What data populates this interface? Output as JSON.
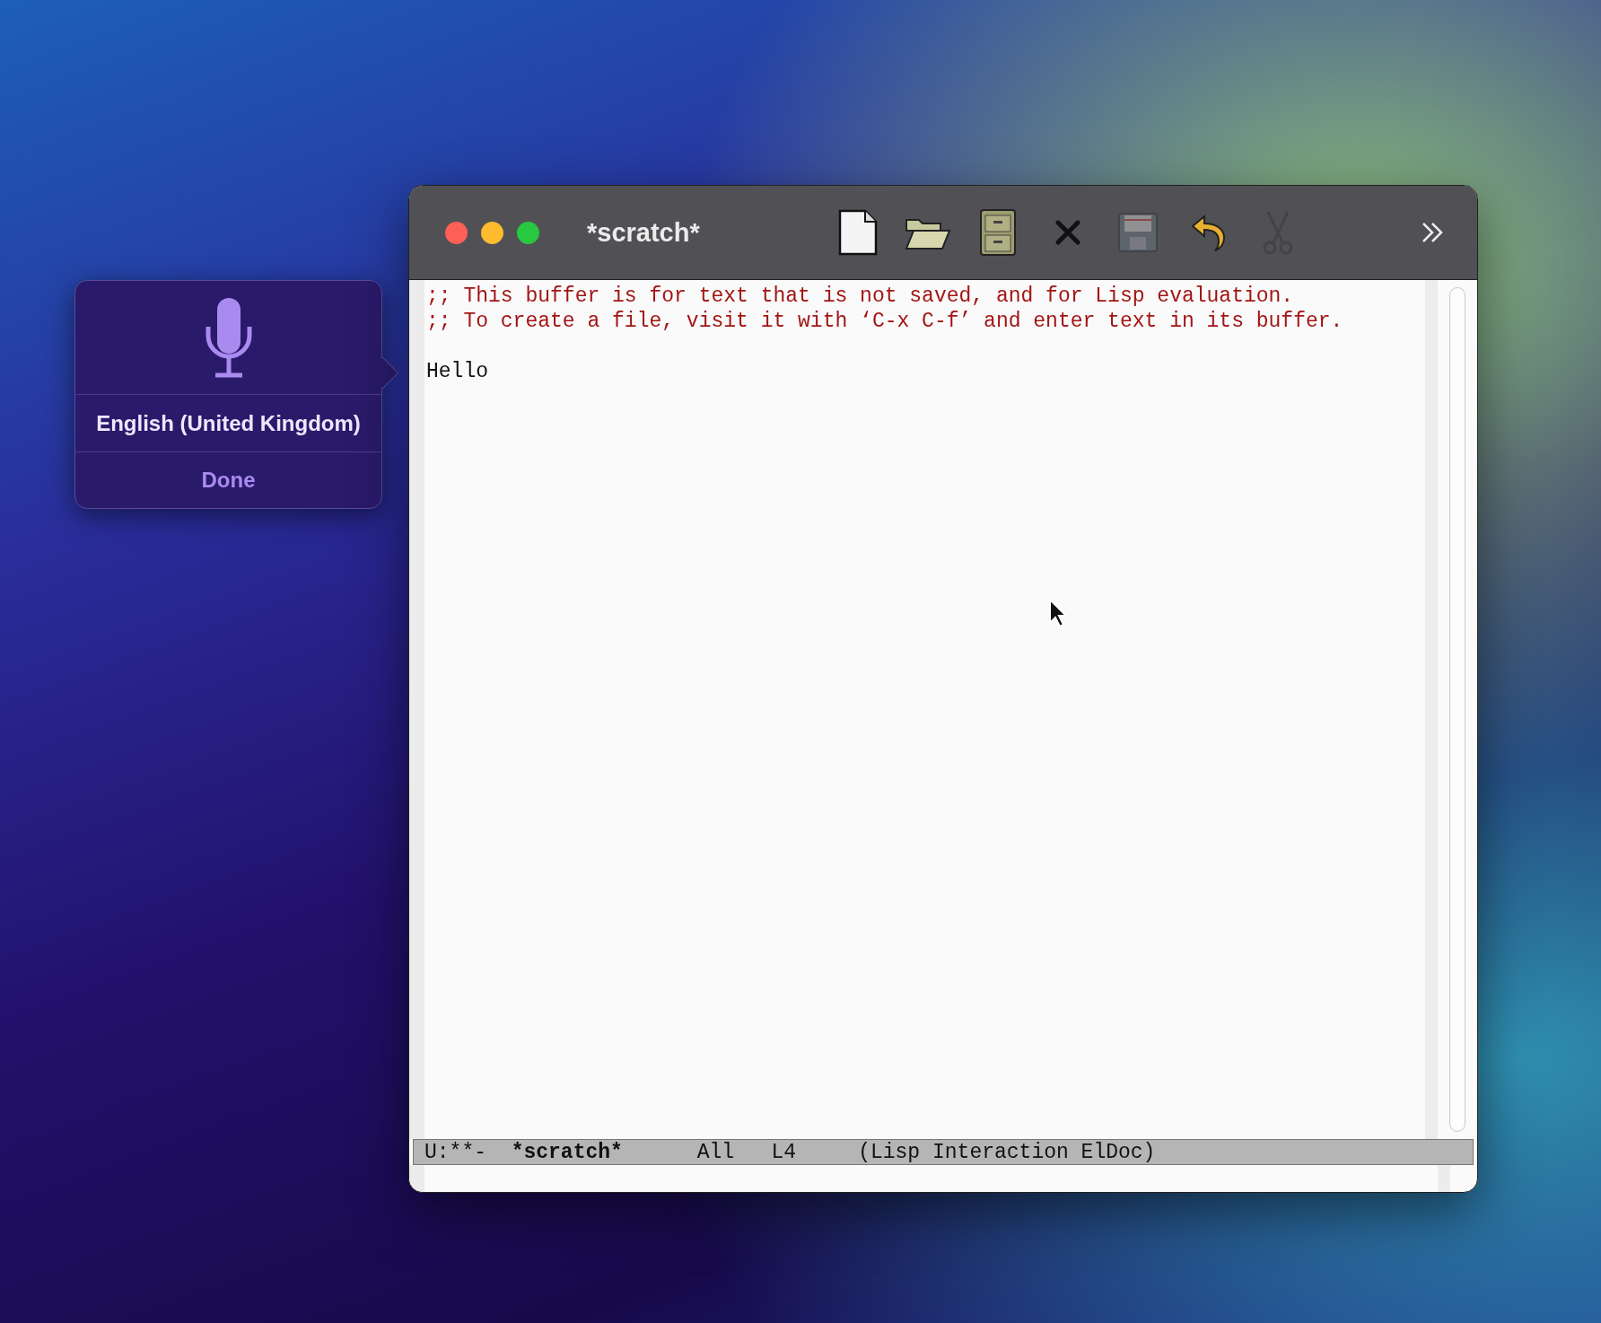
{
  "dictation": {
    "language": "English (United Kingdom)",
    "button": "Done"
  },
  "window": {
    "title": "*scratch*"
  },
  "toolbar": [
    {
      "kind": "new",
      "disabled": false
    },
    {
      "kind": "open",
      "disabled": false
    },
    {
      "kind": "cabinet",
      "disabled": false
    },
    {
      "kind": "close",
      "disabled": false
    },
    {
      "kind": "save",
      "disabled": true
    },
    {
      "kind": "undo",
      "disabled": false
    },
    {
      "kind": "cut",
      "disabled": true
    },
    {
      "kind": "overflow",
      "disabled": false
    }
  ],
  "buffer": {
    "lines": [
      {
        "kind": "comment",
        "text": ";; This buffer is for text that is not saved, and for Lisp evaluation."
      },
      {
        "kind": "comment",
        "text": ";; To create a file, visit it with ‘C-x C-f’ and enter text in its buffer."
      },
      {
        "kind": "blank"
      },
      {
        "kind": "code",
        "text": "Hello"
      }
    ]
  },
  "mode_line": [
    {
      "text": "U:**-",
      "bold": false
    },
    {
      "text": "*scratch*",
      "bold": true
    },
    {
      "text": "All",
      "bold": false
    },
    {
      "text": "L4",
      "bold": false
    },
    {
      "text": "(Lisp Interaction ElDoc)",
      "bold": false
    }
  ]
}
